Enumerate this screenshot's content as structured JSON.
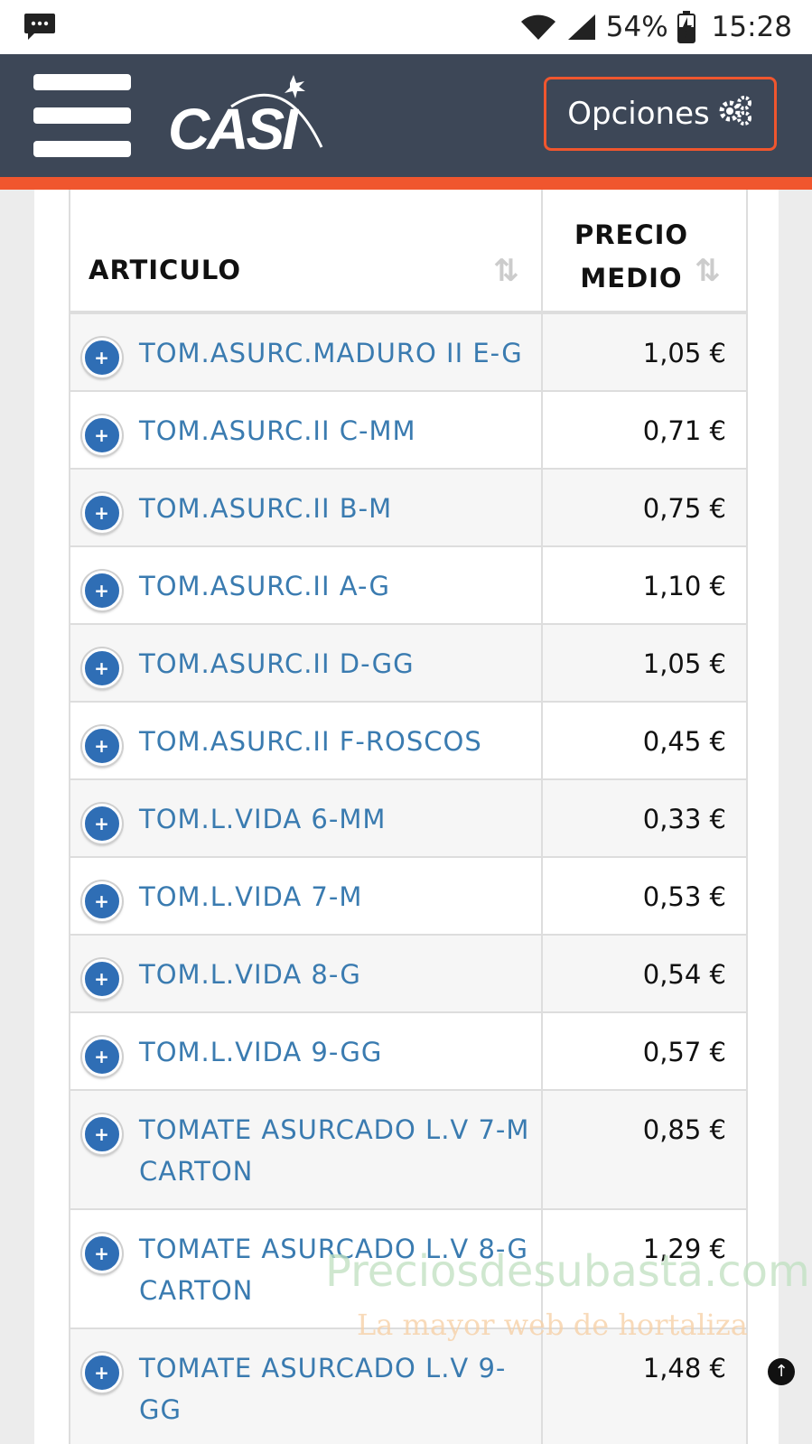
{
  "status_bar": {
    "battery": "54%",
    "time": "15:28"
  },
  "header": {
    "logo_text": "CASI",
    "options_label": "Opciones"
  },
  "table": {
    "col_article": "ARTICULO",
    "col_price": "PRECIO MEDIO",
    "rows": [
      {
        "name": "TOM.ASURC.MADURO II E-G",
        "price": "1,05 €"
      },
      {
        "name": "TOM.ASURC.II C-MM",
        "price": "0,71 €"
      },
      {
        "name": "TOM.ASURC.II B-M",
        "price": "0,75 €"
      },
      {
        "name": "TOM.ASURC.II A-G",
        "price": "1,10 €"
      },
      {
        "name": "TOM.ASURC.II D-GG",
        "price": "1,05 €"
      },
      {
        "name": "TOM.ASURC.II F-ROSCOS",
        "price": "0,45 €"
      },
      {
        "name": "TOM.L.VIDA 6-MM",
        "price": "0,33 €"
      },
      {
        "name": "TOM.L.VIDA 7-M",
        "price": "0,53 €"
      },
      {
        "name": "TOM.L.VIDA 8-G",
        "price": "0,54 €"
      },
      {
        "name": "TOM.L.VIDA 9-GG",
        "price": "0,57 €"
      },
      {
        "name": "TOMATE ASURCADO L.V 7-M CARTON",
        "price": "0,85 €"
      },
      {
        "name": "TOMATE ASURCADO L.V 8-G CARTON",
        "price": "1,29 €"
      },
      {
        "name": "TOMATE ASURCADO L.V 9-GG",
        "price": "1,48 €"
      }
    ]
  },
  "watermark": {
    "site": "Preciosdesubasta.com",
    "tagline": "La mayor web de hortaliza"
  }
}
